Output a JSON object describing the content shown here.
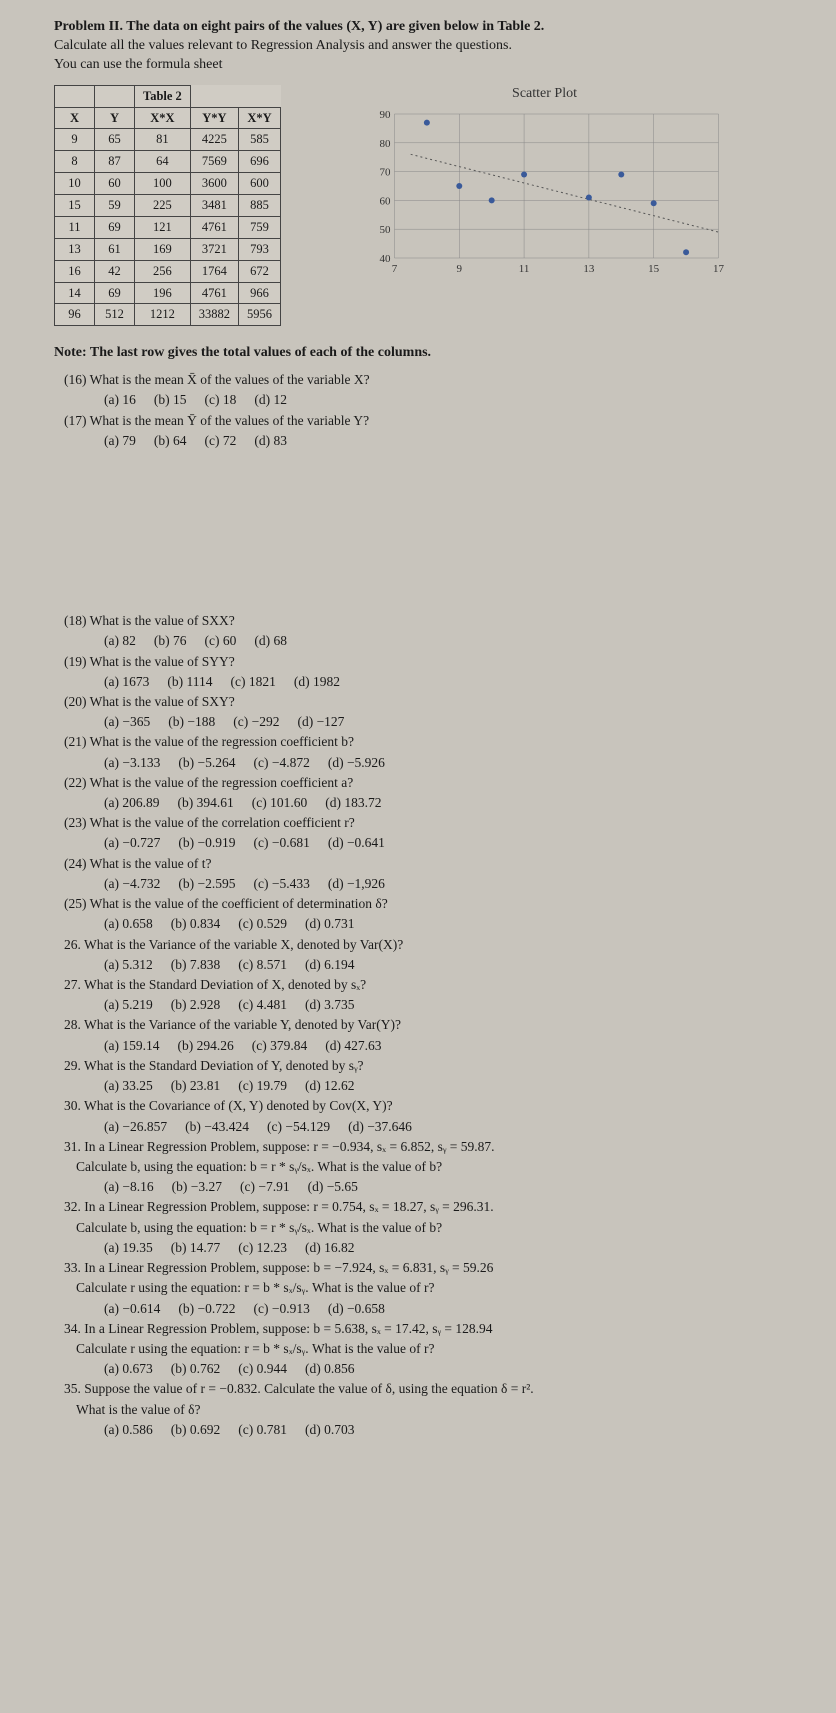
{
  "intro": {
    "line1": "Problem II. The data on eight pairs of the values (X, Y) are given below in Table 2.",
    "line2": "Calculate all the values relevant to Regression Analysis and answer the questions.",
    "line3": "You can use the formula sheet"
  },
  "table": {
    "label": "Table 2",
    "headers": [
      "X",
      "Y",
      "X*X",
      "Y*Y",
      "X*Y"
    ],
    "rows": [
      [
        "9",
        "65",
        "81",
        "4225",
        "585"
      ],
      [
        "8",
        "87",
        "64",
        "7569",
        "696"
      ],
      [
        "10",
        "60",
        "100",
        "3600",
        "600"
      ],
      [
        "15",
        "59",
        "225",
        "3481",
        "885"
      ],
      [
        "11",
        "69",
        "121",
        "4761",
        "759"
      ],
      [
        "13",
        "61",
        "169",
        "3721",
        "793"
      ],
      [
        "16",
        "42",
        "256",
        "1764",
        "672"
      ],
      [
        "14",
        "69",
        "196",
        "4761",
        "966"
      ],
      [
        "96",
        "512",
        "1212",
        "33882",
        "5956"
      ]
    ]
  },
  "chart_data": {
    "type": "scatter",
    "title": "Scatter Plot",
    "xlabel": "",
    "ylabel": "",
    "x_ticks": [
      7,
      9,
      11,
      13,
      15,
      17
    ],
    "y_ticks": [
      40,
      50,
      60,
      70,
      80,
      90
    ],
    "xlim": [
      7,
      17
    ],
    "ylim": [
      40,
      90
    ],
    "points": [
      {
        "x": 9,
        "y": 65
      },
      {
        "x": 8,
        "y": 87
      },
      {
        "x": 10,
        "y": 60
      },
      {
        "x": 15,
        "y": 59
      },
      {
        "x": 11,
        "y": 69
      },
      {
        "x": 13,
        "y": 61
      },
      {
        "x": 16,
        "y": 42
      },
      {
        "x": 14,
        "y": 69
      }
    ]
  },
  "note": "Note: The last row gives the total values of each of the columns.",
  "questions": [
    {
      "n": "(16)",
      "txt": "What is the mean X̄ of the values of the variable X?",
      "opts": [
        "(a) 16",
        "(b) 15",
        "(c) 18",
        "(d) 12"
      ]
    },
    {
      "n": "(17)",
      "txt": "What is the mean Ȳ of the values of the variable Y?",
      "opts": [
        "(a) 79",
        "(b) 64",
        "(c) 72",
        "(d) 83"
      ]
    },
    {
      "n": "(18)",
      "txt": "What is the value of SXX?",
      "opts": [
        "(a) 82",
        "(b) 76",
        "(c) 60",
        "(d) 68"
      ]
    },
    {
      "n": "(19)",
      "txt": "What is the value of SYY?",
      "opts": [
        "(a) 1673",
        "(b) 1114",
        "(c) 1821",
        "(d) 1982"
      ]
    },
    {
      "n": "(20)",
      "txt": "What is the value of SXY?",
      "opts": [
        "(a) −365",
        "(b) −188",
        "(c) −292",
        "(d) −127"
      ]
    },
    {
      "n": "(21)",
      "txt": "What is the value of the regression coefficient b?",
      "opts": [
        "(a) −3.133",
        "(b) −5.264",
        "(c) −4.872",
        "(d) −5.926"
      ]
    },
    {
      "n": "(22)",
      "txt": "What is the value of the regression coefficient a?",
      "opts": [
        "(a) 206.89",
        "(b) 394.61",
        "(c) 101.60",
        "(d) 183.72"
      ]
    },
    {
      "n": "(23)",
      "txt": "What is the value of the correlation coefficient r?",
      "opts": [
        "(a) −0.727",
        "(b) −0.919",
        "(c) −0.681",
        "(d) −0.641"
      ]
    },
    {
      "n": "(24)",
      "txt": "What is the value of t?",
      "opts": [
        "(a) −4.732",
        "(b) −2.595",
        "(c) −5.433",
        "(d) −1,926"
      ]
    },
    {
      "n": "(25)",
      "txt": "What is the value of the coefficient of determination δ?",
      "opts": [
        "(a) 0.658",
        "(b) 0.834",
        "(c) 0.529",
        "(d) 0.731"
      ]
    },
    {
      "n": "26.",
      "txt": "What is the Variance of the variable X, denoted by Var(X)?",
      "opts": [
        "(a) 5.312",
        "(b) 7.838",
        "(c) 8.571",
        "(d) 6.194"
      ]
    },
    {
      "n": "27.",
      "txt": "What is the Standard Deviation of X, denoted by sₓ?",
      "opts": [
        "(a) 5.219",
        "(b) 2.928",
        "(c) 4.481",
        "(d) 3.735"
      ]
    },
    {
      "n": "28.",
      "txt": "What is the Variance of the variable Y, denoted by Var(Y)?",
      "opts": [
        "(a) 159.14",
        "(b) 294.26",
        "(c) 379.84",
        "(d) 427.63"
      ]
    },
    {
      "n": "29.",
      "txt": "What is the Standard Deviation of Y, denoted by sᵧ?",
      "opts": [
        "(a) 33.25",
        "(b) 23.81",
        "(c) 19.79",
        "(d) 12.62"
      ]
    },
    {
      "n": "30.",
      "txt": "What is the Covariance of (X, Y) denoted by Cov(X, Y)?",
      "opts": [
        "(a) −26.857",
        "(b) −43.424",
        "(c) −54.129",
        "(d) −37.646"
      ]
    },
    {
      "n": "31.",
      "txt": "In a Linear Regression Problem, suppose: r = −0.934, sₓ = 6.852, sᵧ = 59.87.",
      "extra": "Calculate b, using the equation: b = r * sᵧ/sₓ.    What is the value of b?",
      "opts": [
        "(a) −8.16",
        "(b) −3.27",
        "(c) −7.91",
        "(d) −5.65"
      ]
    },
    {
      "n": "32.",
      "txt": "In a Linear Regression Problem, suppose: r = 0.754, sₓ = 18.27, sᵧ = 296.31.",
      "extra": "Calculate b, using the equation: b = r * sᵧ/sₓ.    What is the value of b?",
      "opts": [
        "(a) 19.35",
        "(b) 14.77",
        "(c) 12.23",
        "(d) 16.82"
      ]
    },
    {
      "n": "33.",
      "txt": "In a Linear Regression Problem, suppose: b = −7.924, sₓ = 6.831, sᵧ = 59.26",
      "extra": "Calculate r using the equation: r = b * sₓ/sᵧ. What is the value of r?",
      "opts": [
        "(a) −0.614",
        "(b) −0.722",
        "(c) −0.913",
        "(d) −0.658"
      ]
    },
    {
      "n": "34.",
      "txt": "In a Linear Regression Problem, suppose: b = 5.638, sₓ = 17.42, sᵧ = 128.94",
      "extra": "Calculate r using the equation: r = b * sₓ/sᵧ. What is the value of r?",
      "opts": [
        "(a) 0.673",
        "(b) 0.762",
        "(c) 0.944",
        "(d) 0.856"
      ]
    },
    {
      "n": "35.",
      "txt": "Suppose the value of r = −0.832. Calculate the value of δ, using the equation δ = r².",
      "extra": "What is the value of δ?",
      "opts": [
        "(a) 0.586",
        "(b) 0.692",
        "(c) 0.781",
        "(d) 0.703"
      ]
    }
  ]
}
